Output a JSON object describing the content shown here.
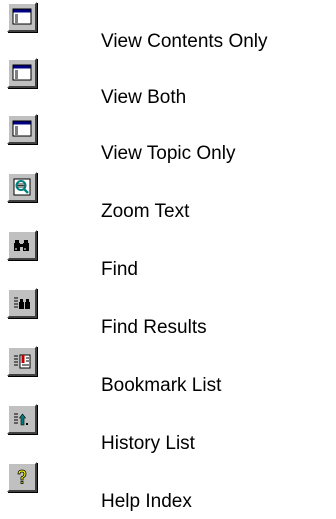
{
  "items": [
    {
      "label": "View Contents Only",
      "icon": "window-icon"
    },
    {
      "label": "View Both",
      "icon": "window-icon"
    },
    {
      "label": "View Topic Only",
      "icon": "window-icon"
    },
    {
      "label": "Zoom Text",
      "icon": "magnifier-icon"
    },
    {
      "label": "Find",
      "icon": "binoculars-icon"
    },
    {
      "label": "Find Results",
      "icon": "find-results-icon"
    },
    {
      "label": "Bookmark List",
      "icon": "bookmark-list-icon"
    },
    {
      "label": "History List",
      "icon": "history-list-icon"
    },
    {
      "label": "Help Index",
      "icon": "help-index-icon"
    }
  ],
  "colors": {
    "button_face": "#c0c0c0",
    "title_bar": "#000080",
    "window_bg": "#ffffff"
  }
}
